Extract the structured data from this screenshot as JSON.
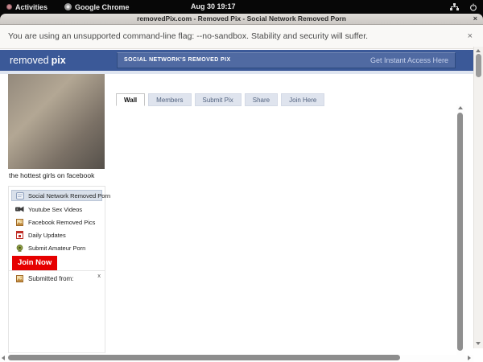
{
  "desktop": {
    "activities_label": "Activities",
    "app_menu_label": "Google Chrome",
    "clock": "Aug 30 19:17"
  },
  "window": {
    "title": "removedPix.com - Removed Pix - Social Network Removed Porn",
    "close_label": "×"
  },
  "warning_bar": {
    "message": "You are using an unsupported command-line flag: --no-sandbox. Stability and security will suffer.",
    "close_label": "×"
  },
  "site": {
    "logo_word1": "removed",
    "logo_word2": "pix",
    "banner_title": "SOCIAL NETWORK'S REMOVED PIX",
    "access_link_label": "Get Instant Access Here",
    "photo_caption": "the hottest girls on facebook",
    "tabs": [
      {
        "label": "Wall",
        "active": true
      },
      {
        "label": "Members",
        "active": false
      },
      {
        "label": "Submit Pix",
        "active": false
      },
      {
        "label": "Share",
        "active": false
      },
      {
        "label": "Join Here",
        "active": false
      }
    ],
    "sidebar": {
      "items": [
        {
          "label": "Social Network Removed Porn",
          "icon": "wall-post-icon",
          "active": true
        },
        {
          "label": "Youtube Sex Videos",
          "icon": "video-camera-icon",
          "active": false
        },
        {
          "label": "Facebook Removed Pics",
          "icon": "photo-icon",
          "active": false
        },
        {
          "label": "Daily Updates",
          "icon": "calendar-icon",
          "active": false
        },
        {
          "label": "Submit Amateur Porn",
          "icon": "webcam-icon",
          "active": false
        }
      ],
      "join_button_label": "Join Now",
      "submitted_from_label": "Submitted from:",
      "submitted_close_label": "x"
    },
    "colors": {
      "brand_blue": "#3b5998",
      "banner_blue": "#506aa2",
      "join_red": "#e60000",
      "active_item_bg": "#d9e0ea"
    }
  }
}
